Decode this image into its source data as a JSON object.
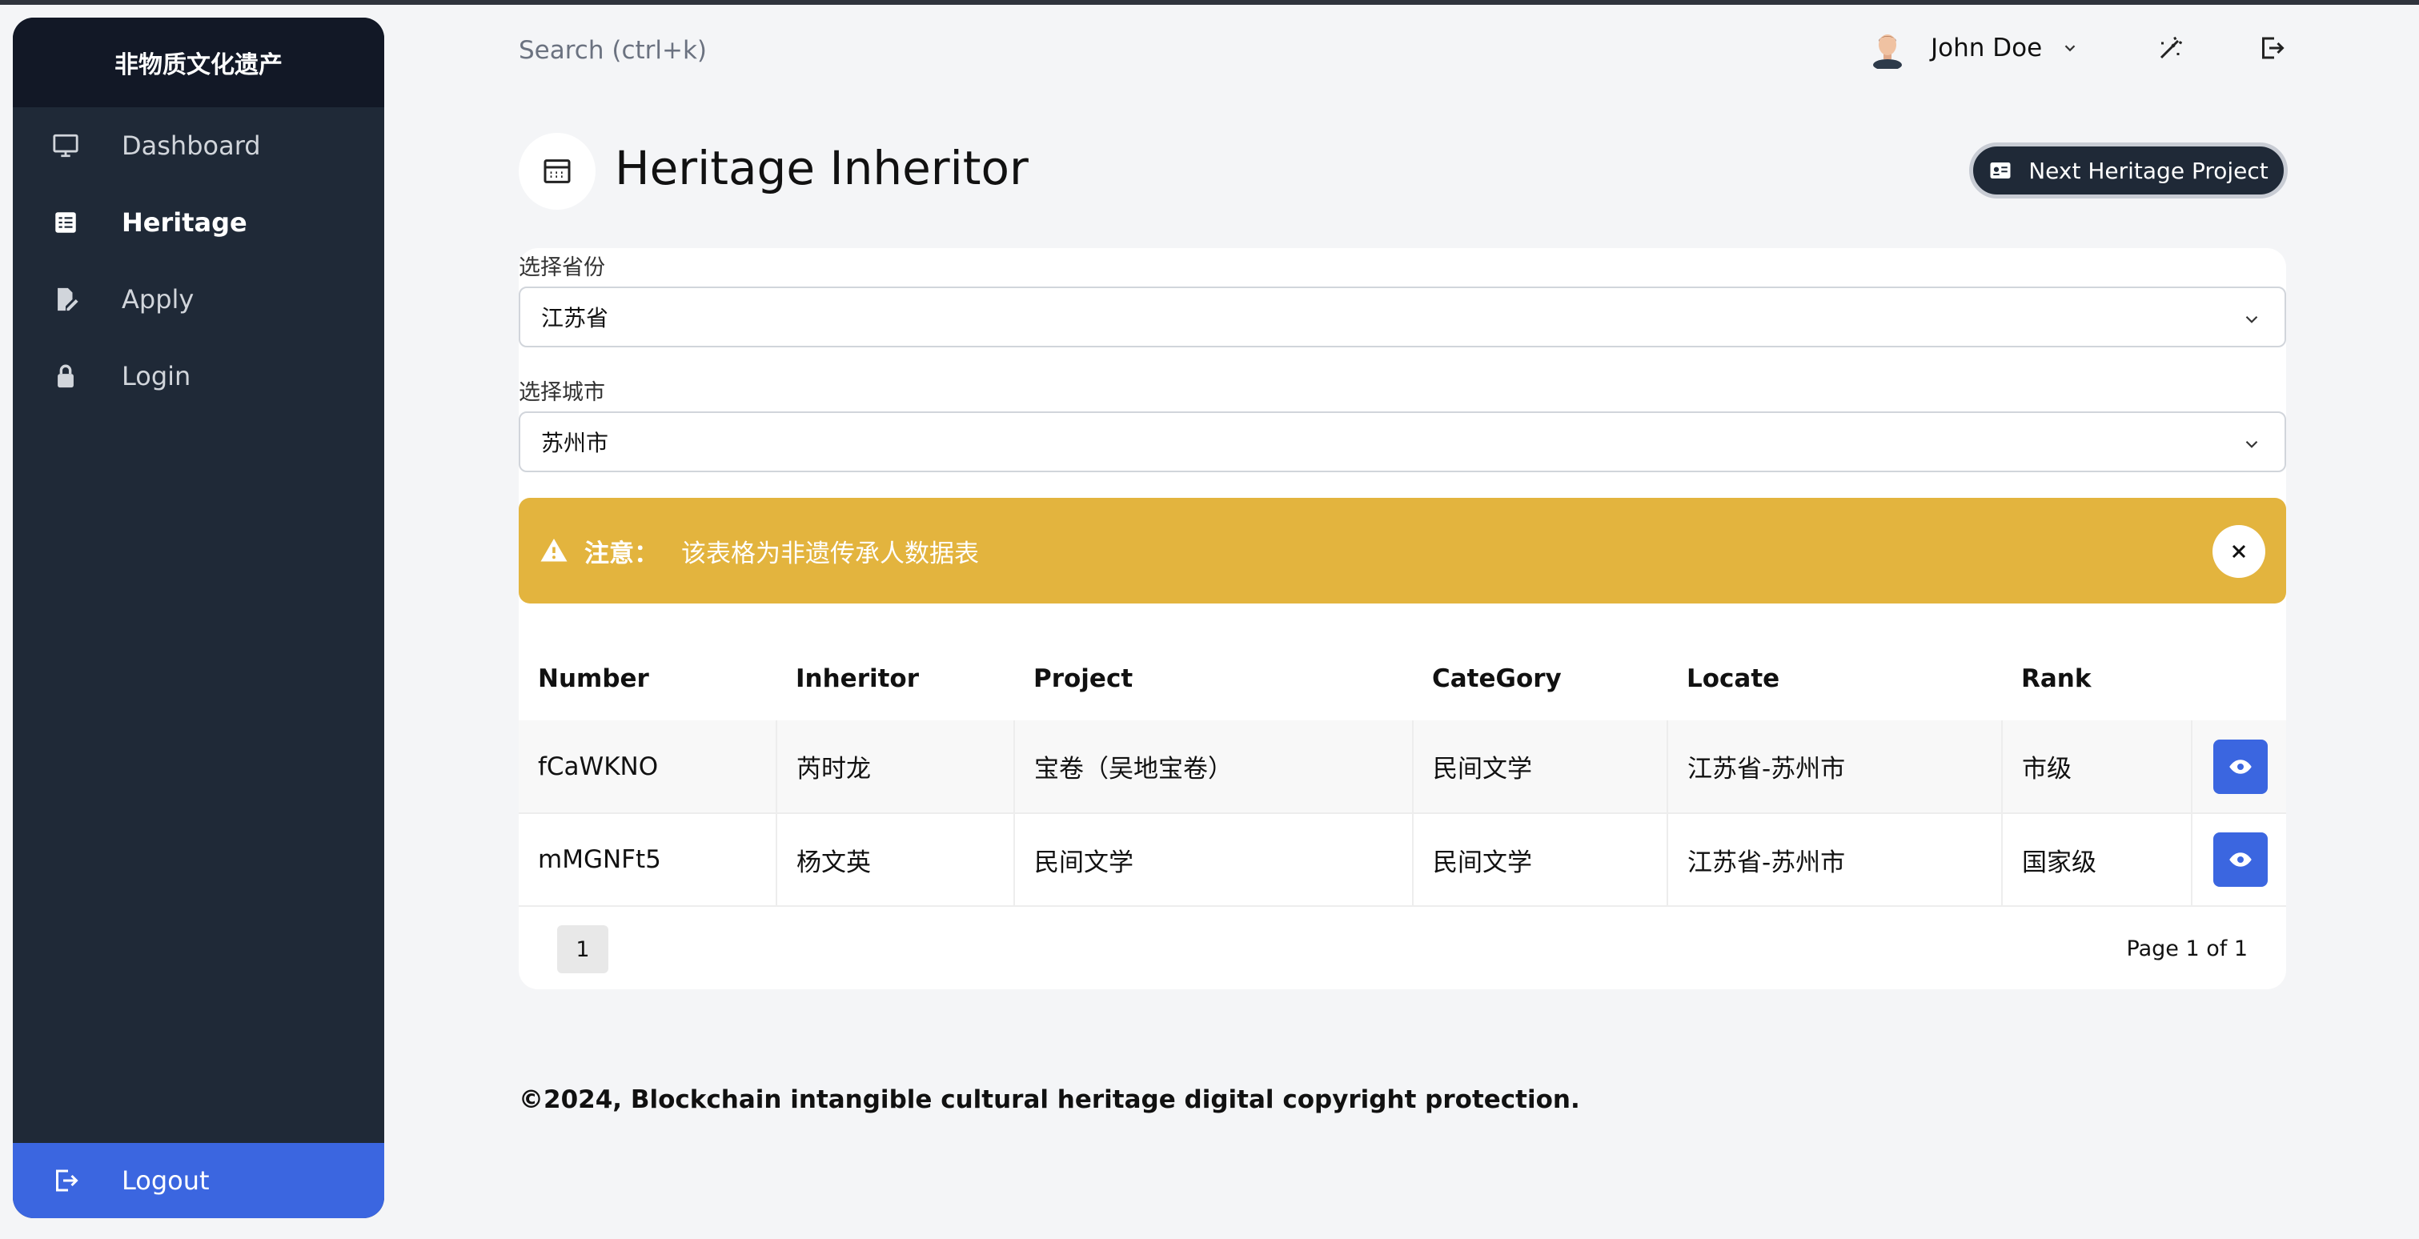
{
  "app": {
    "brand": "非物质文化遗产"
  },
  "sidebar": {
    "items": [
      {
        "label": "Dashboard",
        "icon": "monitor-icon"
      },
      {
        "label": "Heritage",
        "icon": "table-icon",
        "active": true
      },
      {
        "label": "Apply",
        "icon": "document-edit-icon"
      },
      {
        "label": "Login",
        "icon": "lock-icon"
      }
    ],
    "logout": {
      "label": "Logout",
      "icon": "logout-icon"
    }
  },
  "topbar": {
    "search_placeholder": "Search (ctrl+k)",
    "user_name": "John Doe"
  },
  "header": {
    "title": "Heritage Inheritor",
    "next_button": "Next Heritage Project"
  },
  "filters": {
    "province_label": "选择省份",
    "province_value": "江苏省",
    "city_label": "选择城市",
    "city_value": "苏州市"
  },
  "alert": {
    "title": "注意：",
    "message": "该表格为非遗传承人数据表"
  },
  "table": {
    "headers": [
      "Number",
      "Inheritor",
      "Project",
      "CateGory",
      "Locate",
      "Rank"
    ],
    "rows": [
      [
        "fCaWKNO",
        "芮时龙",
        "宝卷（吴地宝卷）",
        "民间文学",
        "江苏省-苏州市",
        "市级"
      ],
      [
        "mMGNFt5",
        "杨文英",
        "民间文学",
        "民间文学",
        "江苏省-苏州市",
        "国家级"
      ]
    ]
  },
  "pagination": {
    "current": "1",
    "info": "Page 1 of 1"
  },
  "footer": {
    "text": "©2024, Blockchain intangible cultural heritage digital copyright protection."
  },
  "colors": {
    "sidebar": "#1f2937",
    "accent": "#3b66e0",
    "alert": "#e3b43e"
  }
}
